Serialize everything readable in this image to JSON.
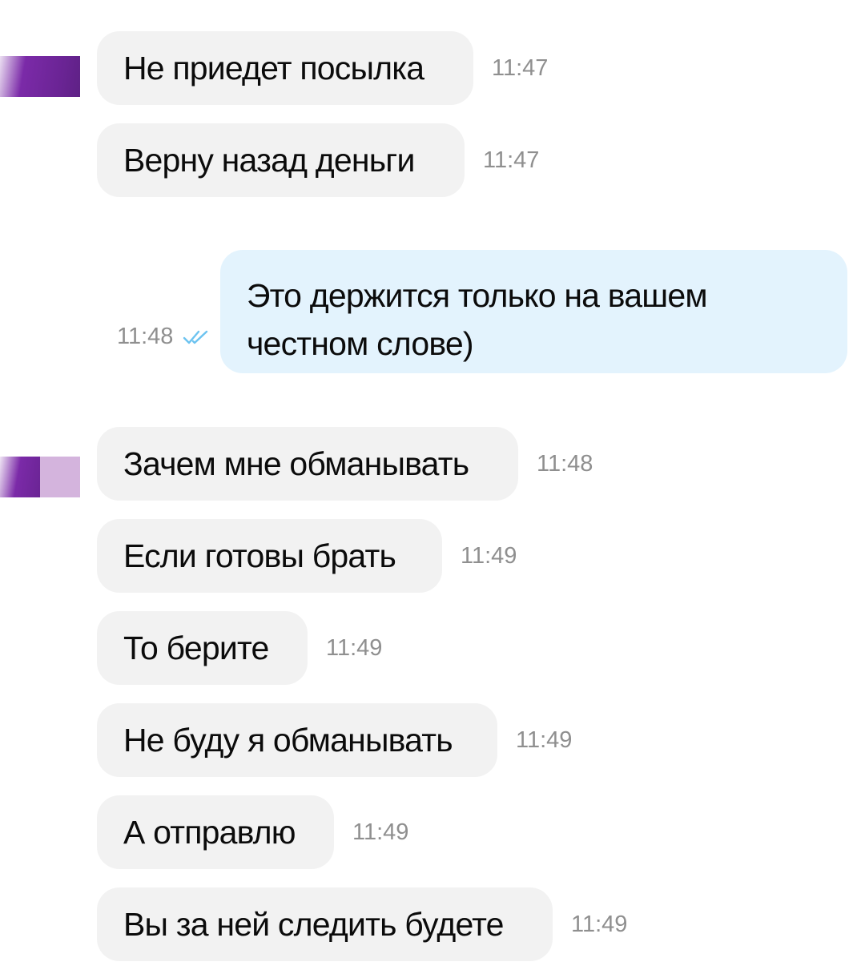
{
  "messages_in_group1": [
    {
      "text": "Не приедет посылка",
      "time": "11:47"
    },
    {
      "text": "Верну назад деньги",
      "time": "11:47"
    }
  ],
  "outgoing": {
    "lines": [
      "Это держится только на вашем",
      "честном слове)"
    ],
    "time": "11:48",
    "status_icon": "double-check-icon"
  },
  "messages_in_group2": [
    {
      "text": "Зачем мне обманывать",
      "time": "11:48"
    },
    {
      "text": "Если готовы брать",
      "time": "11:49"
    },
    {
      "text": "То берите",
      "time": "11:49"
    },
    {
      "text": "Не буду я обманывать",
      "time": "11:49"
    },
    {
      "text": "А отправлю",
      "time": "11:49"
    },
    {
      "text": "Вы за ней следить будете",
      "time": "11:49"
    }
  ],
  "colors": {
    "incoming_bubble": "#f2f2f2",
    "outgoing_bubble": "#e3f3fd",
    "time_text": "#8f8f8f",
    "check_color": "#6cc3f0",
    "avatar_purple": "#7b2aa8",
    "avatar_lilac": "#d4b4dd"
  }
}
